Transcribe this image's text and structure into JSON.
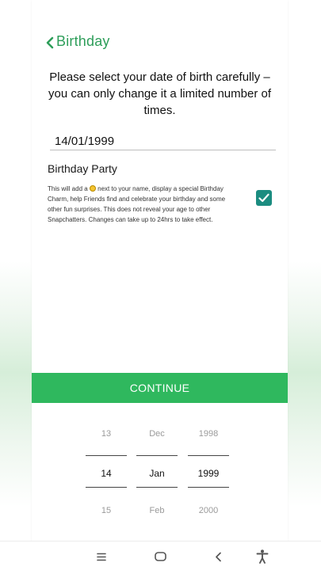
{
  "header": {
    "back_icon": "chevron-left-icon",
    "title": "Birthday"
  },
  "instruction": "Please select your date of birth carefully – you can only change it a limited number of times.",
  "date_field": {
    "value": "14/01/1999"
  },
  "birthday_party": {
    "title": "Birthday Party",
    "desc_before": "This will add a ",
    "desc_icon": "smiley-face-icon",
    "desc_after": " next to your name, display a special Birthday Charm, help Friends find and celebrate your birthday and some other fun surprises. This does not reveal your age to other Snapchatters. Changes can take up to 24hrs to take effect.",
    "checked": true
  },
  "continue_label": "CONTINUE",
  "picker": {
    "day": {
      "prev": "13",
      "selected": "14",
      "next": "15"
    },
    "month": {
      "prev": "Dec",
      "selected": "Jan",
      "next": "Feb"
    },
    "year": {
      "prev": "1998",
      "selected": "1999",
      "next": "2000"
    }
  },
  "colors": {
    "accent": "#2e9e5a",
    "button": "#2fb85e",
    "checkbox": "#1b8c80"
  },
  "navbar": {
    "icons": [
      "menu-icon",
      "home-icon",
      "back-icon",
      "accessibility-icon"
    ]
  }
}
